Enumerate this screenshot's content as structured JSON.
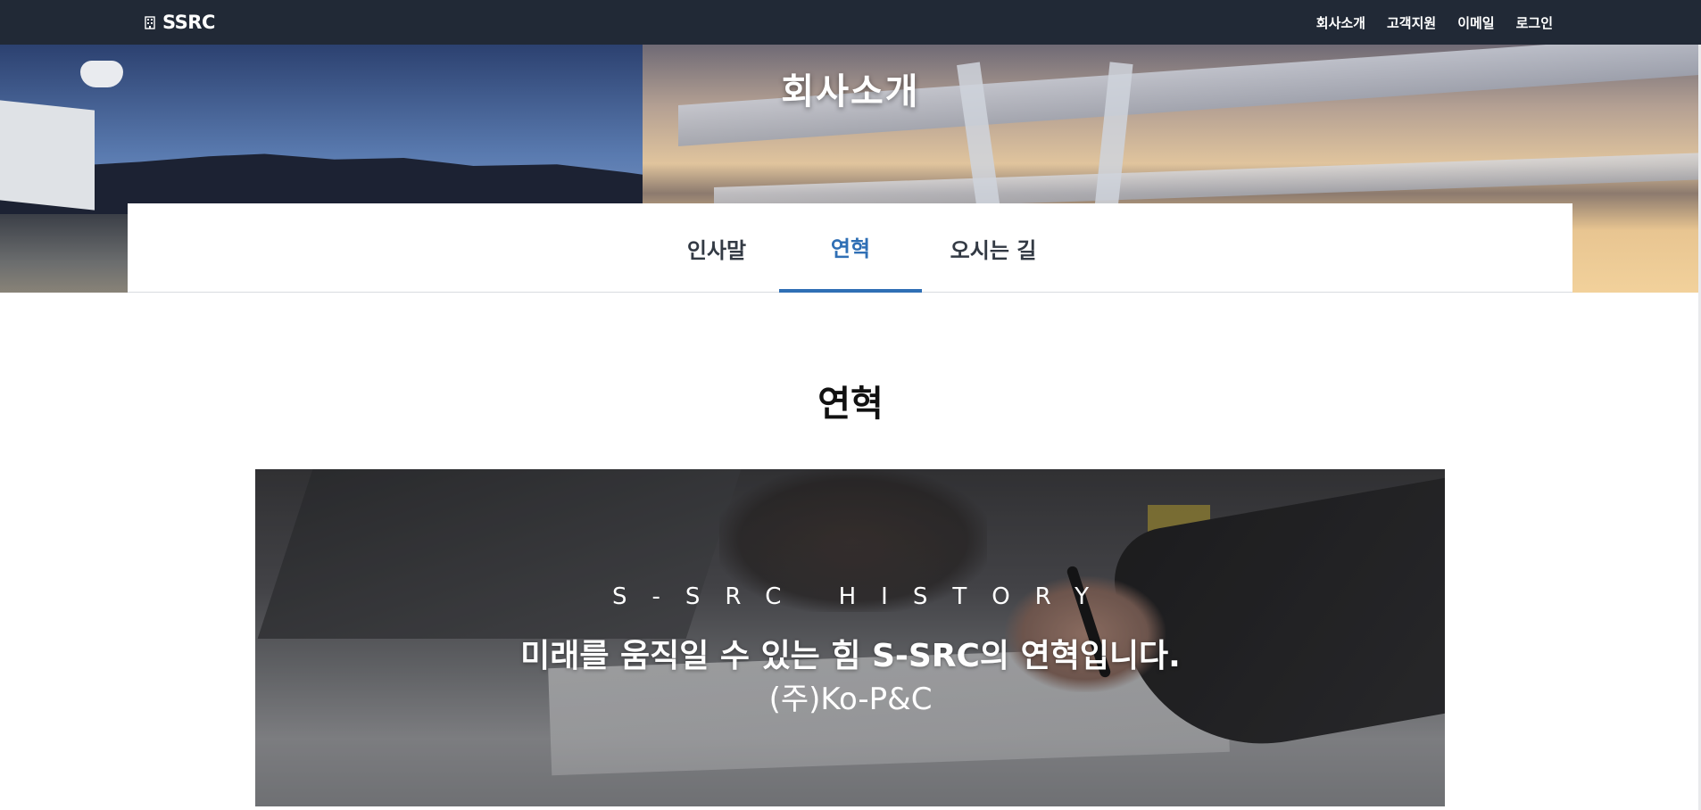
{
  "navbar": {
    "brand": "SSRC",
    "brand_icon": "building-icon",
    "links": [
      "회사소개",
      "고객지원",
      "이메일",
      "로그인"
    ]
  },
  "hero": {
    "title": "회사소개"
  },
  "tabs": [
    {
      "label": "인사말",
      "active": false
    },
    {
      "label": "연혁",
      "active": true
    },
    {
      "label": "오시는 길",
      "active": false
    }
  ],
  "section": {
    "title": "연혁"
  },
  "history_banner": {
    "eyebrow": "S-SRC HISTORY",
    "headline": "미래를 움직일 수 있는 힘 S-SRC의 연혁입니다.",
    "company": "(주)Ko-P&C"
  },
  "colors": {
    "navbar_bg": "#212936",
    "active_tab": "#2f6fb5",
    "text_dark": "#111111"
  }
}
